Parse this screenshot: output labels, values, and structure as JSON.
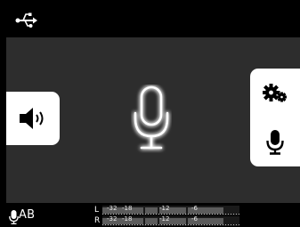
{
  "top_bar": {
    "usb_icon": "usb-icon"
  },
  "left_panel": {
    "speaker_icon": "speaker-volume-icon"
  },
  "center": {
    "mic_icon": "microphone-icon"
  },
  "right_panel": {
    "settings_icon": "gears-icon",
    "mic_icon": "microphone-icon"
  },
  "bottom_bar": {
    "source_label": "AB",
    "channels": [
      {
        "label": "L",
        "ticks": [
          "-32",
          "-18",
          "-12",
          "-6"
        ]
      },
      {
        "label": "R",
        "ticks": [
          "-32",
          "-18",
          "-12",
          "-6"
        ]
      }
    ]
  },
  "colors": {
    "background": "#000000",
    "panel": "#2d2d2d",
    "button": "#ffffff",
    "mic_glow": "#ffffff"
  }
}
